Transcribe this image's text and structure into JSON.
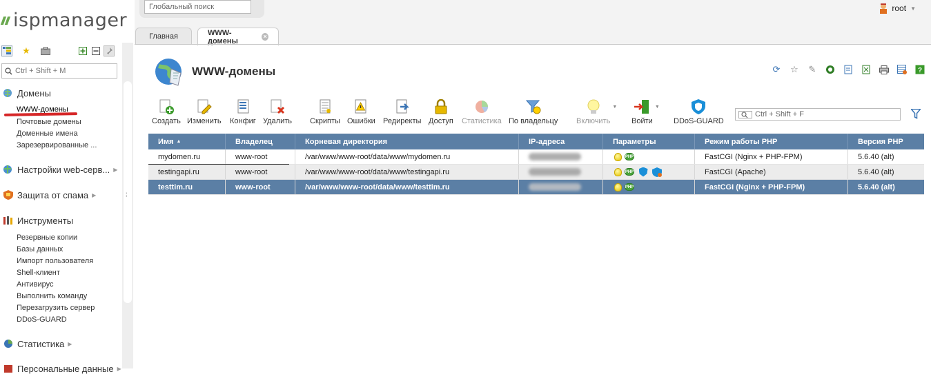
{
  "logo": {
    "text": "ispmanager"
  },
  "sidebar": {
    "search_placeholder": "Ctrl + Shift + M",
    "groups": {
      "domains": "Домены",
      "webserver": "Настройки web-серв...",
      "spam": "Защита от спама",
      "tools": "Инструменты",
      "stats": "Статистика",
      "personal": "Персональные данные"
    },
    "domains_items": [
      "WWW-домены",
      "Почтовые домены",
      "Доменные имена",
      "Зарезервированные ..."
    ],
    "tools_items": [
      "Резервные копии",
      "Базы данных",
      "Импорт пользователя",
      "Shell-клиент",
      "Антивирус",
      "Выполнить команду",
      "Перезагрузить сервер",
      "DDoS-GUARD"
    ]
  },
  "topbar": {
    "global_search": "Глобальный поиск",
    "user": "root"
  },
  "tabs": {
    "home": "Главная",
    "www": "WWW-домены"
  },
  "page": {
    "title": "WWW-домены"
  },
  "toolbar": {
    "create": "Создать",
    "edit": "Изменить",
    "config": "Конфиг",
    "delete": "Удалить",
    "scripts": "Скрипты",
    "errors": "Ошибки",
    "redirects": "Редиректы",
    "access": "Доступ",
    "statistics": "Статистика",
    "by_owner": "По владельцу",
    "enable": "Включить",
    "login": "Войти",
    "ddos": "DDoS-GUARD"
  },
  "filter": {
    "placeholder": "Ctrl + Shift + F"
  },
  "table": {
    "headers": {
      "name": "Имя",
      "owner": "Владелец",
      "root": "Корневая директория",
      "ip": "IP-адреса",
      "params": "Параметры",
      "php_mode": "Режим работы PHP",
      "php_ver": "Версия PHP"
    },
    "rows": [
      {
        "name": "mydomen.ru",
        "owner": "www-root",
        "root": "/var/www/www-root/data/www/mydomen.ru",
        "php_mode": "FastCGI (Nginx + PHP-FPM)",
        "php_ver": "5.6.40 (alt)"
      },
      {
        "name": "testingapi.ru",
        "owner": "www-root",
        "root": "/var/www/www-root/data/www/testingapi.ru",
        "php_mode": "FastCGI (Apache)",
        "php_ver": "5.6.40 (alt)"
      },
      {
        "name": "testtim.ru",
        "owner": "www-root",
        "root": "/var/www/www-root/data/www/testtim.ru",
        "php_mode": "FastCGI (Nginx + PHP-FPM)",
        "php_ver": "5.6.40 (alt)"
      }
    ],
    "php_badge": "PHP"
  },
  "colors": {
    "header_bg": "#5b7fa5",
    "selected_row": "#5b7fa5",
    "accent_green": "#6aa84f",
    "underline_red": "#d62728"
  }
}
